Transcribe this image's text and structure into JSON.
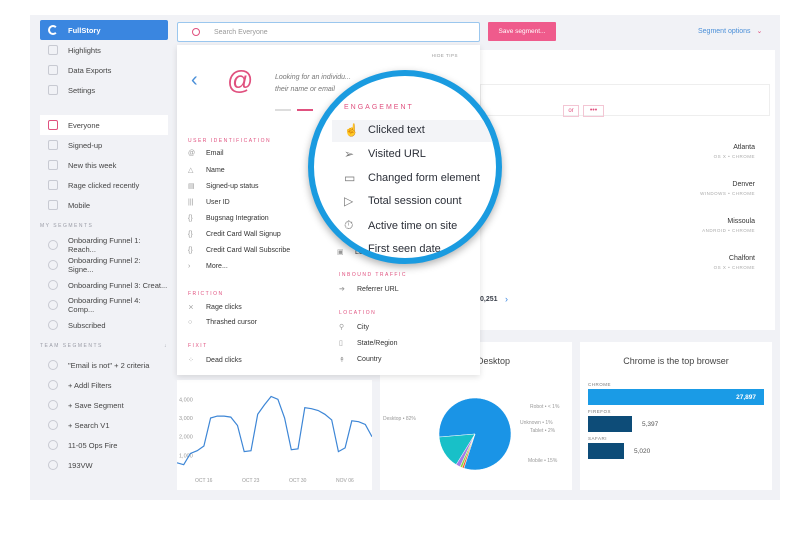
{
  "sidebar": {
    "brand": "FullStory",
    "top": [
      "Highlights",
      "Data Exports",
      "Settings"
    ],
    "segments": [
      "Everyone",
      "Signed-up",
      "New this week",
      "Rage clicked recently",
      "Mobile"
    ],
    "my_header": "MY SEGMENTS",
    "my": [
      "Onboarding Funnel 1: Reach...",
      "Onboarding Funnel 2: Signe...",
      "Onboarding Funnel 3: Creat...",
      "Onboarding Funnel 4: Comp...",
      "Subscribed"
    ],
    "team_header": "TEAM SEGMENTS",
    "team": [
      "\"Email is not\" + 2 criteria",
      "+ Addl Filters",
      "+ Save Segment",
      "+ Search V1",
      "11-05 Ops Fire",
      "193VW"
    ]
  },
  "header": {
    "search_placeholder": "Search Everyone",
    "save": "Save segment...",
    "options": "Segment options"
  },
  "filter": {
    "or": "or",
    "more": "•••"
  },
  "rows": [
    {
      "city": "Atlanta",
      "os": "OS X • CHROME"
    },
    {
      "city": "Denver",
      "os": "WINDOWS • CHROME"
    },
    {
      "city": "Missoula",
      "os": "ANDROID • CHROME"
    },
    {
      "city": "Chalfont",
      "os": "OS X • CHROME"
    }
  ],
  "partial": {
    "ents": "ENTS",
    "count": "0,251"
  },
  "dropdown": {
    "hide_tips": "HIDE TIPS",
    "tip": "Looking for an individu... their name or email",
    "user_header": "USER IDENTIFICATION",
    "user": [
      "Email",
      "Name",
      "Signed-up status",
      "User ID",
      "Bugsnag Integration",
      "Credit Card Wall Signup",
      "Credit Card Wall Subscribe",
      "More..."
    ],
    "friction_header": "FRICTION",
    "friction": [
      "Rage clicks",
      "Thrashed cursor"
    ],
    "fixit_header": "FIXIT",
    "fixit": [
      "Dead clicks"
    ],
    "partial_item": "Lo",
    "inbound_header": "INBOUND TRAFFIC",
    "inbound": [
      "Referrer URL"
    ],
    "location_header": "LOCATION",
    "location": [
      "City",
      "State/Region",
      "Country"
    ]
  },
  "magnifier": {
    "header": "ENGAGEMENT",
    "items": [
      "Clicked text",
      "Visited URL",
      "Changed form element",
      "Total session count",
      "Active time on site",
      "First seen date"
    ]
  },
  "accent": "#e0517f",
  "ring": "#1a9be0",
  "chart_data": [
    {
      "type": "line",
      "yticks": [
        "1,000",
        "2,000",
        "3,000",
        "4,000"
      ],
      "xticks": [
        "OCT 16",
        "OCT 23",
        "OCT 30",
        "NOV 06"
      ],
      "ylim": [
        0,
        4500
      ],
      "values": [
        600,
        500,
        1100,
        1250,
        1500,
        3000,
        3100,
        3100,
        3050,
        2600,
        1200,
        1250,
        3200,
        3700,
        4150,
        4000,
        3000,
        1300,
        1350,
        3550,
        3500,
        3400,
        3200,
        2900,
        1200,
        1400,
        2850,
        2800,
        2650,
        2000
      ]
    },
    {
      "type": "pie",
      "title": "s are on Desktop",
      "slices": [
        {
          "label": "Desktop • 82%",
          "value": 82,
          "color": "#1a94e6"
        },
        {
          "label": "Mobile • 15%",
          "value": 15,
          "color": "#18c0c8"
        },
        {
          "label": "Tablet • 2%",
          "value": 2,
          "color": "#a27ee6"
        },
        {
          "label": "Unknown • 1%",
          "value": 1,
          "color": "#8cd63c"
        },
        {
          "label": "Robot • < 1%",
          "value": 0.8,
          "color": "#f05a2a"
        }
      ]
    },
    {
      "type": "bar",
      "title": "Chrome is the top browser",
      "categories": [
        "CHROME",
        "FIREFOX",
        "SAFARI"
      ],
      "values": [
        27897
      ],
      "labels": [
        "27,897",
        "5,397",
        "5,020"
      ],
      "colors": [
        "#1a9be6",
        "#0d4c78",
        "#0d4c78"
      ]
    }
  ]
}
